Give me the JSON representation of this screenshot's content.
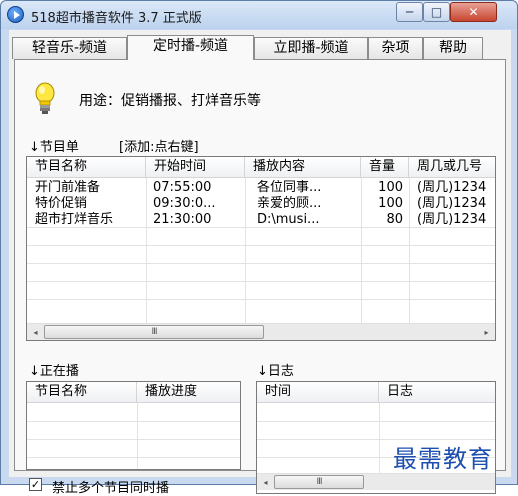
{
  "window": {
    "title": "518超市播音软件 3.7 正式版",
    "min_label": "─",
    "max_label": "□",
    "close_label": "✕"
  },
  "tabs": [
    {
      "label": "轻音乐-频道",
      "active": false
    },
    {
      "label": "定时播-频道",
      "active": true
    },
    {
      "label": "立即播-频道",
      "active": false
    },
    {
      "label": "杂项",
      "active": false
    },
    {
      "label": "帮助",
      "active": false
    }
  ],
  "purpose": "用途：促销播报、打烊音乐等",
  "program_list": {
    "label": "↓节目单",
    "hint": "[添加:点右键]",
    "columns": [
      "节目名称",
      "开始时间",
      "播放内容",
      "音量",
      "周几或几号"
    ],
    "rows": [
      [
        "开门前准备",
        "07:55:00",
        "各位同事...",
        "100",
        "(周几)1234"
      ],
      [
        "特价促销",
        "09:30:0...",
        "亲爱的顾...",
        "100",
        "(周几)1234"
      ],
      [
        "超市打烊音乐",
        "21:30:00",
        "D:\\musi...",
        "80",
        "(周几)1234"
      ]
    ],
    "scroll_left": "◂",
    "scroll_right": "▸",
    "scroll_thumb": "III"
  },
  "now_playing": {
    "label": "↓正在播",
    "columns": [
      "节目名称",
      "播放进度"
    ]
  },
  "log": {
    "label": "↓日志",
    "columns": [
      "时间",
      "日志"
    ],
    "scroll_left": "◂",
    "scroll_thumb": "III"
  },
  "options": {
    "no_simultaneous_label": "禁止多个节目同时播",
    "no_simultaneous_checked": true,
    "check_mark": "✓"
  },
  "watermark": "最需教育",
  "colors": {
    "titlebar": "#c9daf0",
    "close": "#c8452f",
    "watermark": "#1d4fb0"
  }
}
